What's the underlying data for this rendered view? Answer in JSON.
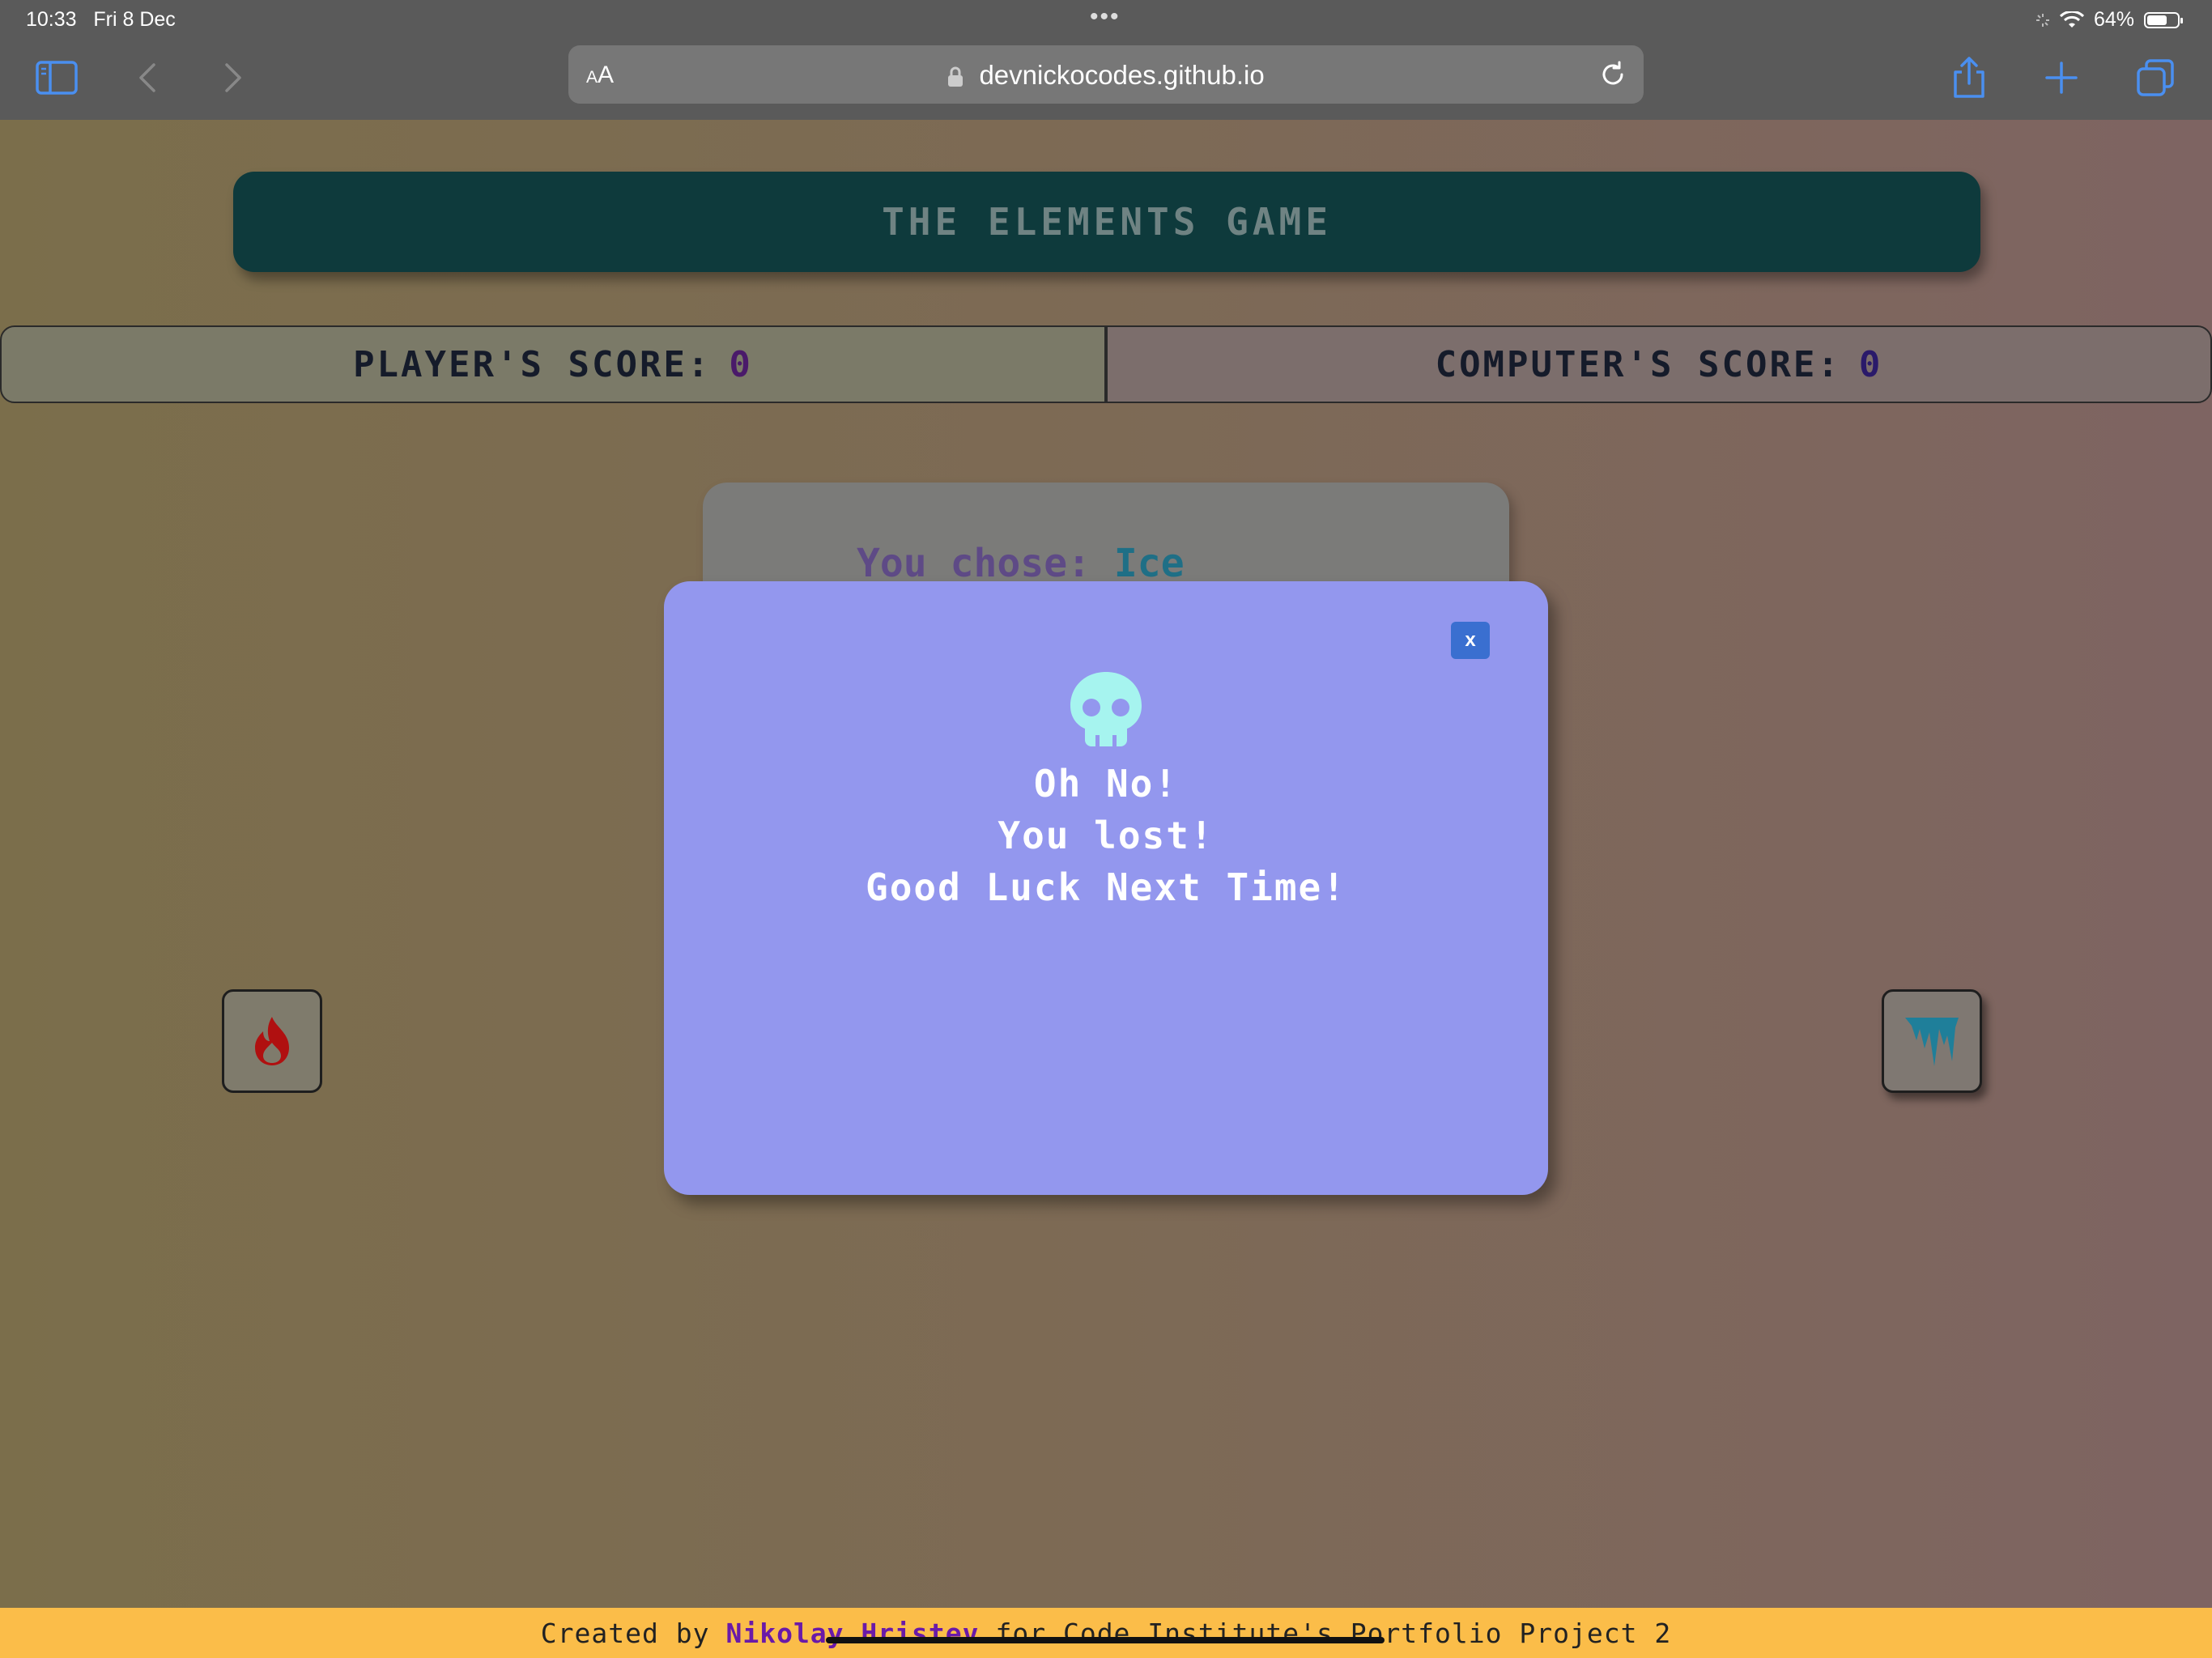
{
  "status_bar": {
    "time": "10:33",
    "date": "Fri 8 Dec",
    "battery": "64%",
    "battery_level": 0.64
  },
  "browser": {
    "aa_label_small": "A",
    "aa_label_big": "A",
    "url": "devnickocodes.github.io",
    "icons": [
      "sidebar-icon",
      "back-icon",
      "forward-icon",
      "lock-icon",
      "reload-icon",
      "share-icon",
      "new-tab-icon",
      "tabs-icon"
    ]
  },
  "game": {
    "title": "THE ELEMENTS GAME",
    "player_score_label": "PLAYER'S SCORE:",
    "player_score": "0",
    "computer_score_label": "COMPUTER'S SCORE:",
    "computer_score": "0",
    "chose_label": "You chose:",
    "chose_value": "Ice",
    "player_choice_icon": "fire-icon",
    "computer_choice_icon": "ice-icon"
  },
  "modal": {
    "close_label": "x",
    "icon": "skull-icon",
    "line1": "Oh No!",
    "line2": "You lost!",
    "line3": "Good Luck Next Time!"
  },
  "footer": {
    "prefix": "Created by",
    "author": "Nikolay Hristev",
    "suffix": "for Code Institute's Portfolio Project 2"
  },
  "colors": {
    "header_bg": "#0e3a3c",
    "modal_bg": "#9397ee",
    "footer_bg": "#fbbd49",
    "close_btn": "#3a6fd0",
    "skull": "#a6f4ef",
    "fire": "#b01010",
    "ice": "#1f7f9a"
  }
}
